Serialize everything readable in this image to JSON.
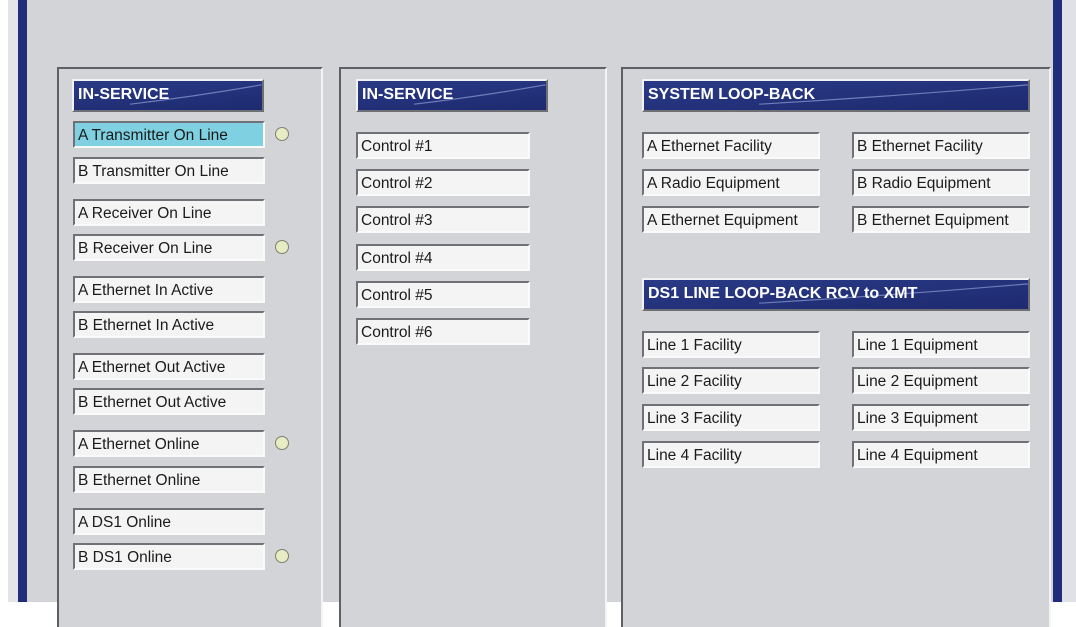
{
  "colors": {
    "header_bg": "#1d2a70",
    "active_button": "#7fd0e0",
    "indicator_led": "#e7ecc3",
    "panel_bg": "#d3d4d7"
  },
  "left_panel": {
    "title": "IN-SERVICE",
    "buttons": [
      {
        "label": "A Transmitter On Line",
        "active": true,
        "indicator": true
      },
      {
        "label": "B Transmitter On Line",
        "active": false,
        "indicator": false
      },
      {
        "label": "A Receiver On Line",
        "active": false,
        "indicator": false
      },
      {
        "label": "B Receiver On Line",
        "active": false,
        "indicator": true
      },
      {
        "label": "A Ethernet In Active",
        "active": false,
        "indicator": false
      },
      {
        "label": "B Ethernet In Active",
        "active": false,
        "indicator": false
      },
      {
        "label": "A Ethernet Out Active",
        "active": false,
        "indicator": false
      },
      {
        "label": "B Ethernet Out Active",
        "active": false,
        "indicator": false
      },
      {
        "label": "A Ethernet Online",
        "active": false,
        "indicator": true
      },
      {
        "label": "B Ethernet Online",
        "active": false,
        "indicator": false
      },
      {
        "label": "A DS1 Online",
        "active": false,
        "indicator": false
      },
      {
        "label": "B DS1 Online",
        "active": false,
        "indicator": true
      }
    ]
  },
  "middle_panel": {
    "title": "IN-SERVICE",
    "buttons": [
      "Control #1",
      "Control #2",
      "Control #3",
      "Control #4",
      "Control #5",
      "Control #6"
    ]
  },
  "right_panel": {
    "system_loopback": {
      "title": "SYSTEM LOOP-BACK",
      "left_buttons": [
        "A Ethernet Facility",
        "A Radio Equipment",
        "A Ethernet Equipment"
      ],
      "right_buttons": [
        "B Ethernet Facility",
        "B Radio Equipment",
        "B Ethernet Equipment"
      ]
    },
    "ds1_loopback": {
      "title": "DS1 LINE LOOP-BACK RCV to XMT",
      "left_buttons": [
        "Line 1 Facility",
        "Line 2 Facility",
        "Line 3 Facility",
        "Line 4 Facility"
      ],
      "right_buttons": [
        "Line 1 Equipment",
        "Line 2 Equipment",
        "Line 3 Equipment",
        "Line 4 Equipment"
      ]
    }
  }
}
